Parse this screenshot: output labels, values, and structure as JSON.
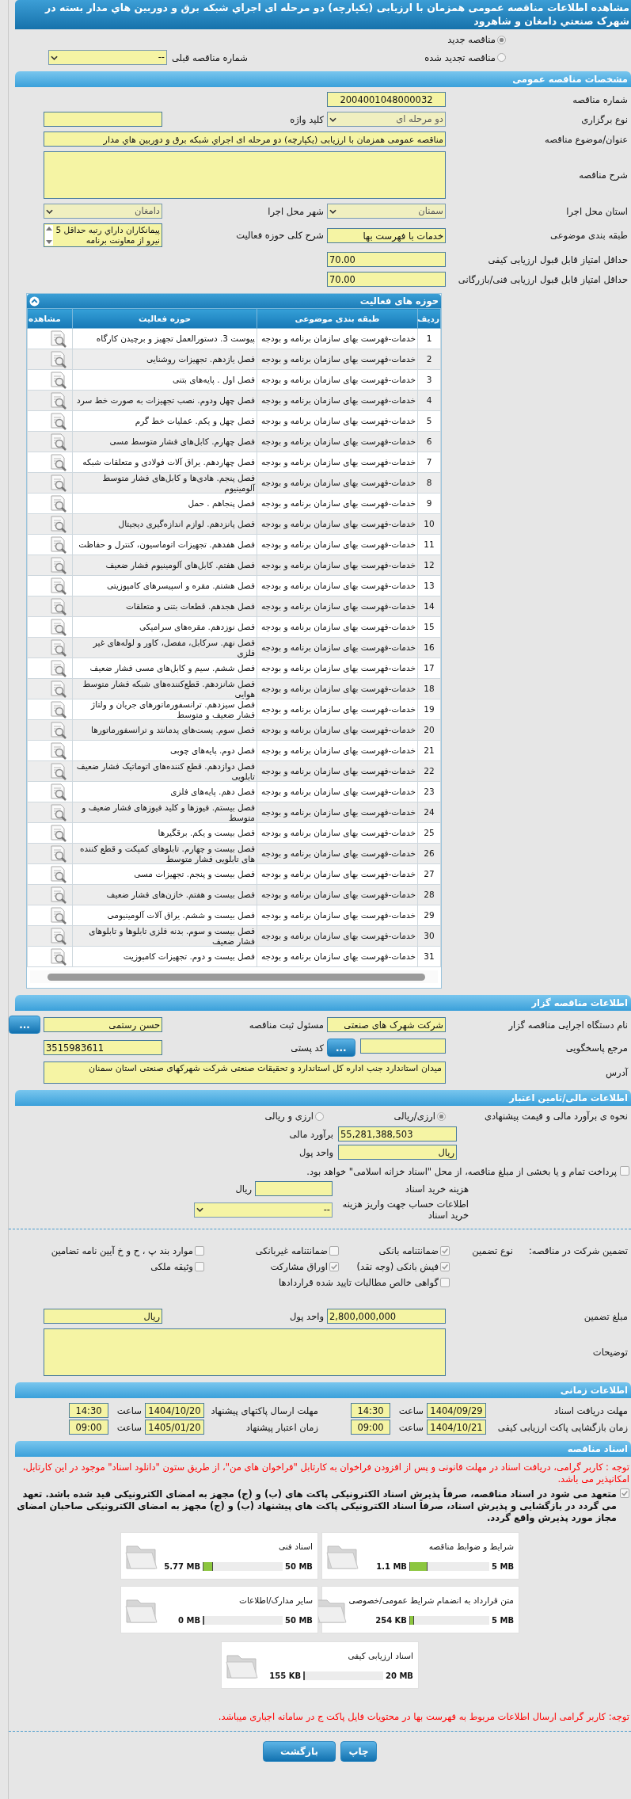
{
  "title": "مشاهده اطلاعات مناقصه عمومی همزمان با ارزیابی (یکپارچه) دو مرحله ای اجراي شبکه برق و دوربین هاي مدار بسته در شهرک صنعتي دامغان و شاهرود",
  "tender_type": [
    {
      "label": "مناقصه جدید",
      "selected": true
    },
    {
      "label": "مناقصه تجدید شده",
      "selected": false
    }
  ],
  "previous_number": {
    "label": "شماره مناقصه قبلی",
    "value": "--",
    "disabled": false
  },
  "general": {
    "header": "مشخصات مناقصه عمومی",
    "number": {
      "label": "شماره مناقصه",
      "value": "2004001048000032"
    },
    "holding_type": {
      "label": "نوع برگزاری",
      "value": "دو مرحله ای",
      "disabled": true
    },
    "keyword": {
      "label": "کلید واژه"
    },
    "subject": {
      "label": "عنوان/موضوع مناقصه",
      "value": "مناقصه عمومی همزمان با ارزیابی (یکپارچه) دو مرحله ای اجراي شبکه برق و دوربین هاي مدار"
    },
    "description": {
      "label": "شرح مناقصه"
    },
    "province": {
      "label": "استان محل اجرا",
      "value": "سمنان",
      "disabled": true
    },
    "city": {
      "label": "شهر محل اجرا",
      "value": "دامغان",
      "disabled": true
    },
    "category": {
      "label": "طبقه بندی موضوعی",
      "value": "خدمات با فهرست بها"
    },
    "activity_summary": {
      "label": "شرح کلی حوزه فعالیت",
      "value": "پیمانکاران داراي رتبه حداقل 5 نیرو  از معاونت برنامه"
    },
    "min_quality": {
      "label": "حداقل امتیاز قابل قبول ارزیابی کیفی",
      "value": "70.00"
    },
    "min_technical": {
      "label": "حداقل امتیاز قابل قبول ارزیابی فنی/بازرگانی",
      "value": "70.00"
    }
  },
  "activities": {
    "header": "حوزه های فعالیت",
    "columns": [
      "ردیف",
      "طبقه بندی موضوعی",
      "حوزه فعالیت",
      "مشاهده"
    ],
    "rows": [
      {
        "number": "1",
        "category": "خدمات-فهرست بهای سازمان برنامه و بودجه",
        "activity": "پیوست 3. دستورالعمل تجهیز و برچیدن کارگاه"
      },
      {
        "number": "2",
        "category": "خدمات-فهرست بهای سازمان برنامه و بودجه",
        "activity": "فصل یازدهم. تجهیزات روشنایی"
      },
      {
        "number": "3",
        "category": "خدمات-فهرست بهای سازمان برنامه و بودجه",
        "activity": "فصل اول . پایه‌های بتنی"
      },
      {
        "number": "4",
        "category": "خدمات-فهرست بهای سازمان برنامه و بودجه",
        "activity": "فصل چهل ودوم. نصب تجهیزات به صورت خط سرد"
      },
      {
        "number": "5",
        "category": "خدمات-فهرست بهای سازمان برنامه و بودجه",
        "activity": "فصل چهل و یکم. عملیات خط گرم"
      },
      {
        "number": "6",
        "category": "خدمات-فهرست بهای سازمان برنامه و بودجه",
        "activity": "فصل چهارم. کابل‌های فشار متوسط مسی"
      },
      {
        "number": "7",
        "category": "خدمات-فهرست بهای سازمان برنامه و بودجه",
        "activity": "فصل چهاردهم. یراق آلات فولادی و متعلقات شبکه"
      },
      {
        "number": "8",
        "category": "خدمات-فهرست بهای سازمان برنامه و بودجه",
        "activity": "فصل پنجم. هادی‌ها و کابل‌های فشار متوسط آلومینیوم"
      },
      {
        "number": "9",
        "category": "خدمات-فهرست بهای سازمان برنامه و بودجه",
        "activity": "فصل پنجاهم . حمل"
      },
      {
        "number": "10",
        "category": "خدمات-فهرست بهای سازمان برنامه و بودجه",
        "activity": "فصل پانزدهم. لوازم اندازه‌گیری دیجیتال"
      },
      {
        "number": "11",
        "category": "خدمات-فهرست بهای سازمان برنامه و بودجه",
        "activity": "فصل هفدهم. تجهیزات اتوماسیون، کنترل و حفاظت"
      },
      {
        "number": "12",
        "category": "خدمات-فهرست بهای سازمان برنامه و بودجه",
        "activity": "فصل هفتم. کابل‌های آلومینیوم فشار ضعیف"
      },
      {
        "number": "13",
        "category": "خدمات-فهرست بهای سازمان برنامه و بودجه",
        "activity": "فصل هشتم. مقره و اسپیسرهای کامپوزیتی"
      },
      {
        "number": "14",
        "category": "خدمات-فهرست بهای سازمان برنامه و بودجه",
        "activity": "فصل هجدهم. قطعات بتنی و متعلقات"
      },
      {
        "number": "15",
        "category": "خدمات-فهرست بهای سازمان برنامه و بودجه",
        "activity": "فصل نوزدهم. مقره‌های سرامیکی"
      },
      {
        "number": "16",
        "category": "خدمات-فهرست بهای سازمان برنامه و بودجه",
        "activity": "فصل نهم. سرکابل، مفصل، کاور و لوله‌های غیر فلزی"
      },
      {
        "number": "17",
        "category": "خدمات-فهرست بهای سازمان برنامه و بودجه",
        "activity": "فصل ششم. سیم و کابل‌های مسی فشار ضعیف"
      },
      {
        "number": "18",
        "category": "خدمات-فهرست بهای سازمان برنامه و بودجه",
        "activity": "فصل شانزدهم. قطع‌کننده‌های شبکه فشار متوسط هوایی"
      },
      {
        "number": "19",
        "category": "خدمات-فهرست بهای سازمان برنامه و بودجه",
        "activity": "فصل سیزدهم. ترانسفورماتورهای جریان و ولتاژ فشار ضعیف و متوسط"
      },
      {
        "number": "20",
        "category": "خدمات-فهرست بهای سازمان برنامه و بودجه",
        "activity": "فصل سوم. پست‌های پدمانتد و ترانسفورماتورها"
      },
      {
        "number": "21",
        "category": "خدمات-فهرست بهای سازمان برنامه و بودجه",
        "activity": "فصل دوم. پایه‌های چوبی"
      },
      {
        "number": "22",
        "category": "خدمات-فهرست بهای سازمان برنامه و بودجه",
        "activity": "فصل دوازدهم. قطع کننده‌های اتوماتیک فشار ضعیف تابلویی"
      },
      {
        "number": "23",
        "category": "خدمات-فهرست بهای سازمان برنامه و بودجه",
        "activity": "فصل دهم. پایه‌های فلزی"
      },
      {
        "number": "24",
        "category": "خدمات-فهرست بهای سازمان برنامه و بودجه",
        "activity": "فصل بیستم. فیوزها و کلید فیوزهای فشار ضعیف و متوسط"
      },
      {
        "number": "25",
        "category": "خدمات-فهرست بهای سازمان برنامه و بودجه",
        "activity": "فصل بیست و یکم. برقگیرها"
      },
      {
        "number": "26",
        "category": "خدمات-فهرست بهای سازمان برنامه و بودجه",
        "activity": "فصل بیست و چهارم. تابلوهای کمپکت و قطع کننده های تابلویی فشار متوسط"
      },
      {
        "number": "27",
        "category": "خدمات-فهرست بهای سازمان برنامه و بودجه",
        "activity": "فصل بیست و پنجم. تجهیزات مسی"
      },
      {
        "number": "28",
        "category": "خدمات-فهرست بهای سازمان برنامه و بودجه",
        "activity": "فصل بیست و هفتم. خازن‌های فشار ضعیف"
      },
      {
        "number": "29",
        "category": "خدمات-فهرست بهای سازمان برنامه و بودجه",
        "activity": "فصل بیست و ششم. یراق آلات آلومینیومی"
      },
      {
        "number": "30",
        "category": "خدمات-فهرست بهای سازمان برنامه و بودجه",
        "activity": "فصل بیست و سوم. بدنه فلزی تابلوها و تابلوهای فشار ضعیف"
      },
      {
        "number": "31",
        "category": "خدمات-فهرست بهای سازمان برنامه و بودجه",
        "activity": "فصل بیست و دوم. تجهیزات کامپوزیت"
      }
    ]
  },
  "organizer": {
    "header": "اطلاعات مناقصه گزار",
    "org_name": {
      "label": "نام دستگاه اجرایی مناقصه گزار",
      "value": "شرکت شهرک های صنعتی"
    },
    "registrar": {
      "label": "مسئول ثبت مناقصه",
      "value": "حسن رستمی",
      "button": "..."
    },
    "reference": {
      "label": "مرجع پاسخگویی",
      "button": "..."
    },
    "postal_code": {
      "label": "کد پستی",
      "value": "3515983611"
    },
    "address": {
      "label": "آدرس",
      "value": "میدان استاندارد جنب اداره کل استاندارد و تحقیقات صنعتی شرکت شهرکهای صنعتی استان سمنان"
    }
  },
  "finance": {
    "header": "اطلاعات مالی/تامین اعتبار",
    "estimate_method": {
      "label": "نحوه ی برآورد مالی و قیمت پیشنهادی",
      "options": [
        {
          "label": "ارزی/ریالی",
          "selected": true
        },
        {
          "label": "ارزی و ریالی",
          "selected": false
        }
      ]
    },
    "estimate": {
      "label": "برآورد مالی",
      "value": "55,281,388,503"
    },
    "currency": {
      "label": "واحد پول",
      "value": "ریال"
    },
    "treasury": {
      "text": "پرداخت تمام و یا بخشی از مبلغ مناقصه، از محل \"اسناد خزانه اسلامی\" خواهد بود.",
      "checked": false
    },
    "doc_fee": {
      "label": "هزینه خرید اسناد",
      "unit": "ریال"
    },
    "account": {
      "label": "اطلاعات حساب جهت واریز هزینه خرید اسناد",
      "value": "--"
    },
    "guarantee": {
      "label": "تضمین شرکت در مناقصه:",
      "type_label": "نوع تضمین",
      "options": [
        {
          "label": "ضمانتنامه بانکی",
          "checked": true
        },
        {
          "label": "ضمانتنامه غیربانکی",
          "checked": false
        },
        {
          "label": "موارد بند پ ، ح و خ آیین نامه تضامین",
          "checked": false
        },
        {
          "label": "فیش بانکی (وجه نقد)",
          "checked": true
        },
        {
          "label": "اوراق مشارکت",
          "checked": true
        },
        {
          "label": "وثیقه ملکی",
          "checked": false
        },
        {
          "label": "گواهی خالص مطالبات تایید شده قراردادها",
          "checked": false
        }
      ]
    },
    "amount": {
      "label": "مبلغ تضمین",
      "value": "2,800,000,000"
    },
    "amount_currency": {
      "label": "واحد پول",
      "value": "ریال"
    },
    "notes": {
      "label": "توضیحات"
    }
  },
  "timing": {
    "header": "اطلاعات زمانی",
    "items": [
      {
        "label": "مهلت دریافت اسناد",
        "date": "1404/09/29",
        "time_label": "ساعت",
        "time": "14:30"
      },
      {
        "label": "مهلت ارسال پاکتهای پیشنهاد",
        "date": "1404/10/20",
        "time_label": "ساعت",
        "time": "14:30"
      },
      {
        "label": "زمان بازگشایی پاکت ارزیابی کیفی",
        "date": "1404/10/21",
        "time_label": "ساعت",
        "time": "09:00"
      },
      {
        "label": "زمان اعتبار پیشنهاد",
        "date": "1405/01/20",
        "time_label": "ساعت",
        "time": "09:00"
      }
    ]
  },
  "documents": {
    "header": "اسناد مناقصه",
    "note": "توجه : کاربر گرامی، دریافت اسناد در مهلت قانونی و پس از افزودن فراخوان به کارتابل \"فراخوان های من\"، از طریق ستون \"دانلود اسناد\" موجود در این کارتابل، امکانپذیر می باشد.",
    "commitment": {
      "text": "متعهد می شود در اسناد مناقصه، صرفاً پذیرش اسناد الکترونیکی پاکت های (ب) و (ج) مجهز به امضای الکترونیکی قید شده باشد. تعهد می گردد در بازگشایی و پذیرش اسناد، صرفاً اسناد الکترونیکی پاکت های پیشنهاد (ب) و (ج) مجهز به امضای الکترونیکی صاحبان امضای مجاز مورد پذیرش واقع گردد.",
      "checked": true
    },
    "files": [
      {
        "name": "شرایط و ضوابط مناقصه",
        "max": "5 MB",
        "size": "1.1 MB",
        "level": 0.22
      },
      {
        "name": "اسناد فنی",
        "max": "50 MB",
        "size": "5.77 MB",
        "level": 0.115
      },
      {
        "name": "متن قرارداد به انضمام شرایط عمومی/خصوصی",
        "max": "5 MB",
        "size": "254 KB",
        "level": 0.05
      },
      {
        "name": "سایر مدارک/اطلاعات",
        "max": "50 MB",
        "size": "0 MB",
        "level": 0
      },
      {
        "name": "اسناد ارزیابی کیفی",
        "max": "20 MB",
        "size": "155 KB",
        "level": 0.008
      }
    ],
    "footer_note": "توجه: کاربر گرامی ارسال اطلاعات مربوط به فهرست بها در محتویات فایل پاکت ج در سامانه اجباری میباشد."
  },
  "buttons": [
    "چاپ",
    "بازگشت"
  ]
}
